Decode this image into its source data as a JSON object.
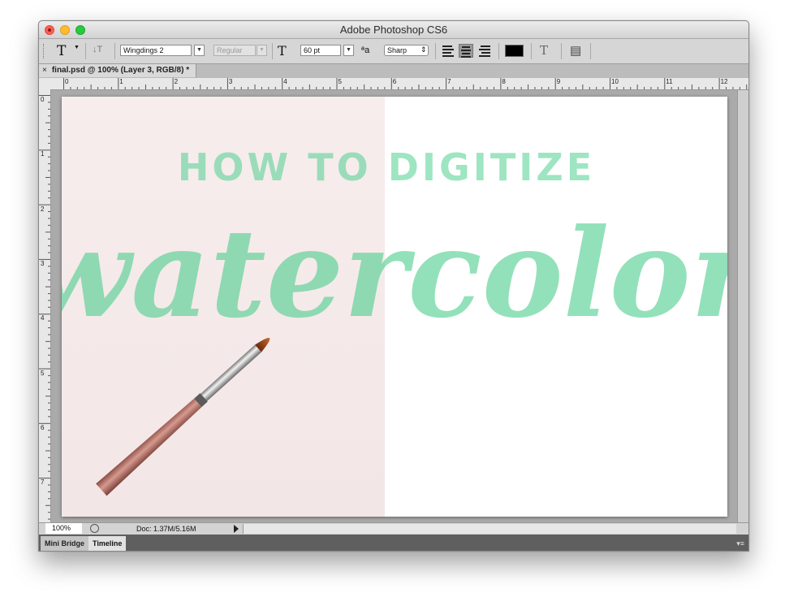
{
  "window": {
    "title": "Adobe Photoshop CS6"
  },
  "options_bar": {
    "tool_icon": "T",
    "tool_icon_name": "type-tool-icon",
    "orientation_icon": "↓T",
    "font_family": "Wingdings 2",
    "font_style": "Regular",
    "size_icon": "T",
    "font_size": "60 pt",
    "aa_icon": "ªa",
    "anti_alias": "Sharp",
    "text_color": "#000000",
    "warp_icon": "T",
    "panel_icon": "▤",
    "dropdown_arrow": "▼",
    "stepper_arrow": "⇕"
  },
  "document_tab": {
    "close": "×",
    "label": "final.psd @ 100% (Layer 3, RGB/8) *"
  },
  "rulers": {
    "horizontal": [
      "0",
      "1",
      "2",
      "3",
      "4",
      "5",
      "6",
      "7",
      "8",
      "9",
      "10",
      "11",
      "12"
    ],
    "vertical": [
      "0",
      "1",
      "2",
      "3",
      "4",
      "5",
      "6",
      "7"
    ]
  },
  "artwork": {
    "line1": "HOW TO DIGITIZE",
    "line2": "watercolor",
    "accent_color": "#4fcf90",
    "paper_color": "#f6ecec"
  },
  "status_bar": {
    "zoom": "100%",
    "doc_info": "Doc: 1.37M/5.16M"
  },
  "panels": {
    "mini_bridge": "Mini Bridge",
    "timeline": "Timeline",
    "menu_icon": "▾≡"
  }
}
